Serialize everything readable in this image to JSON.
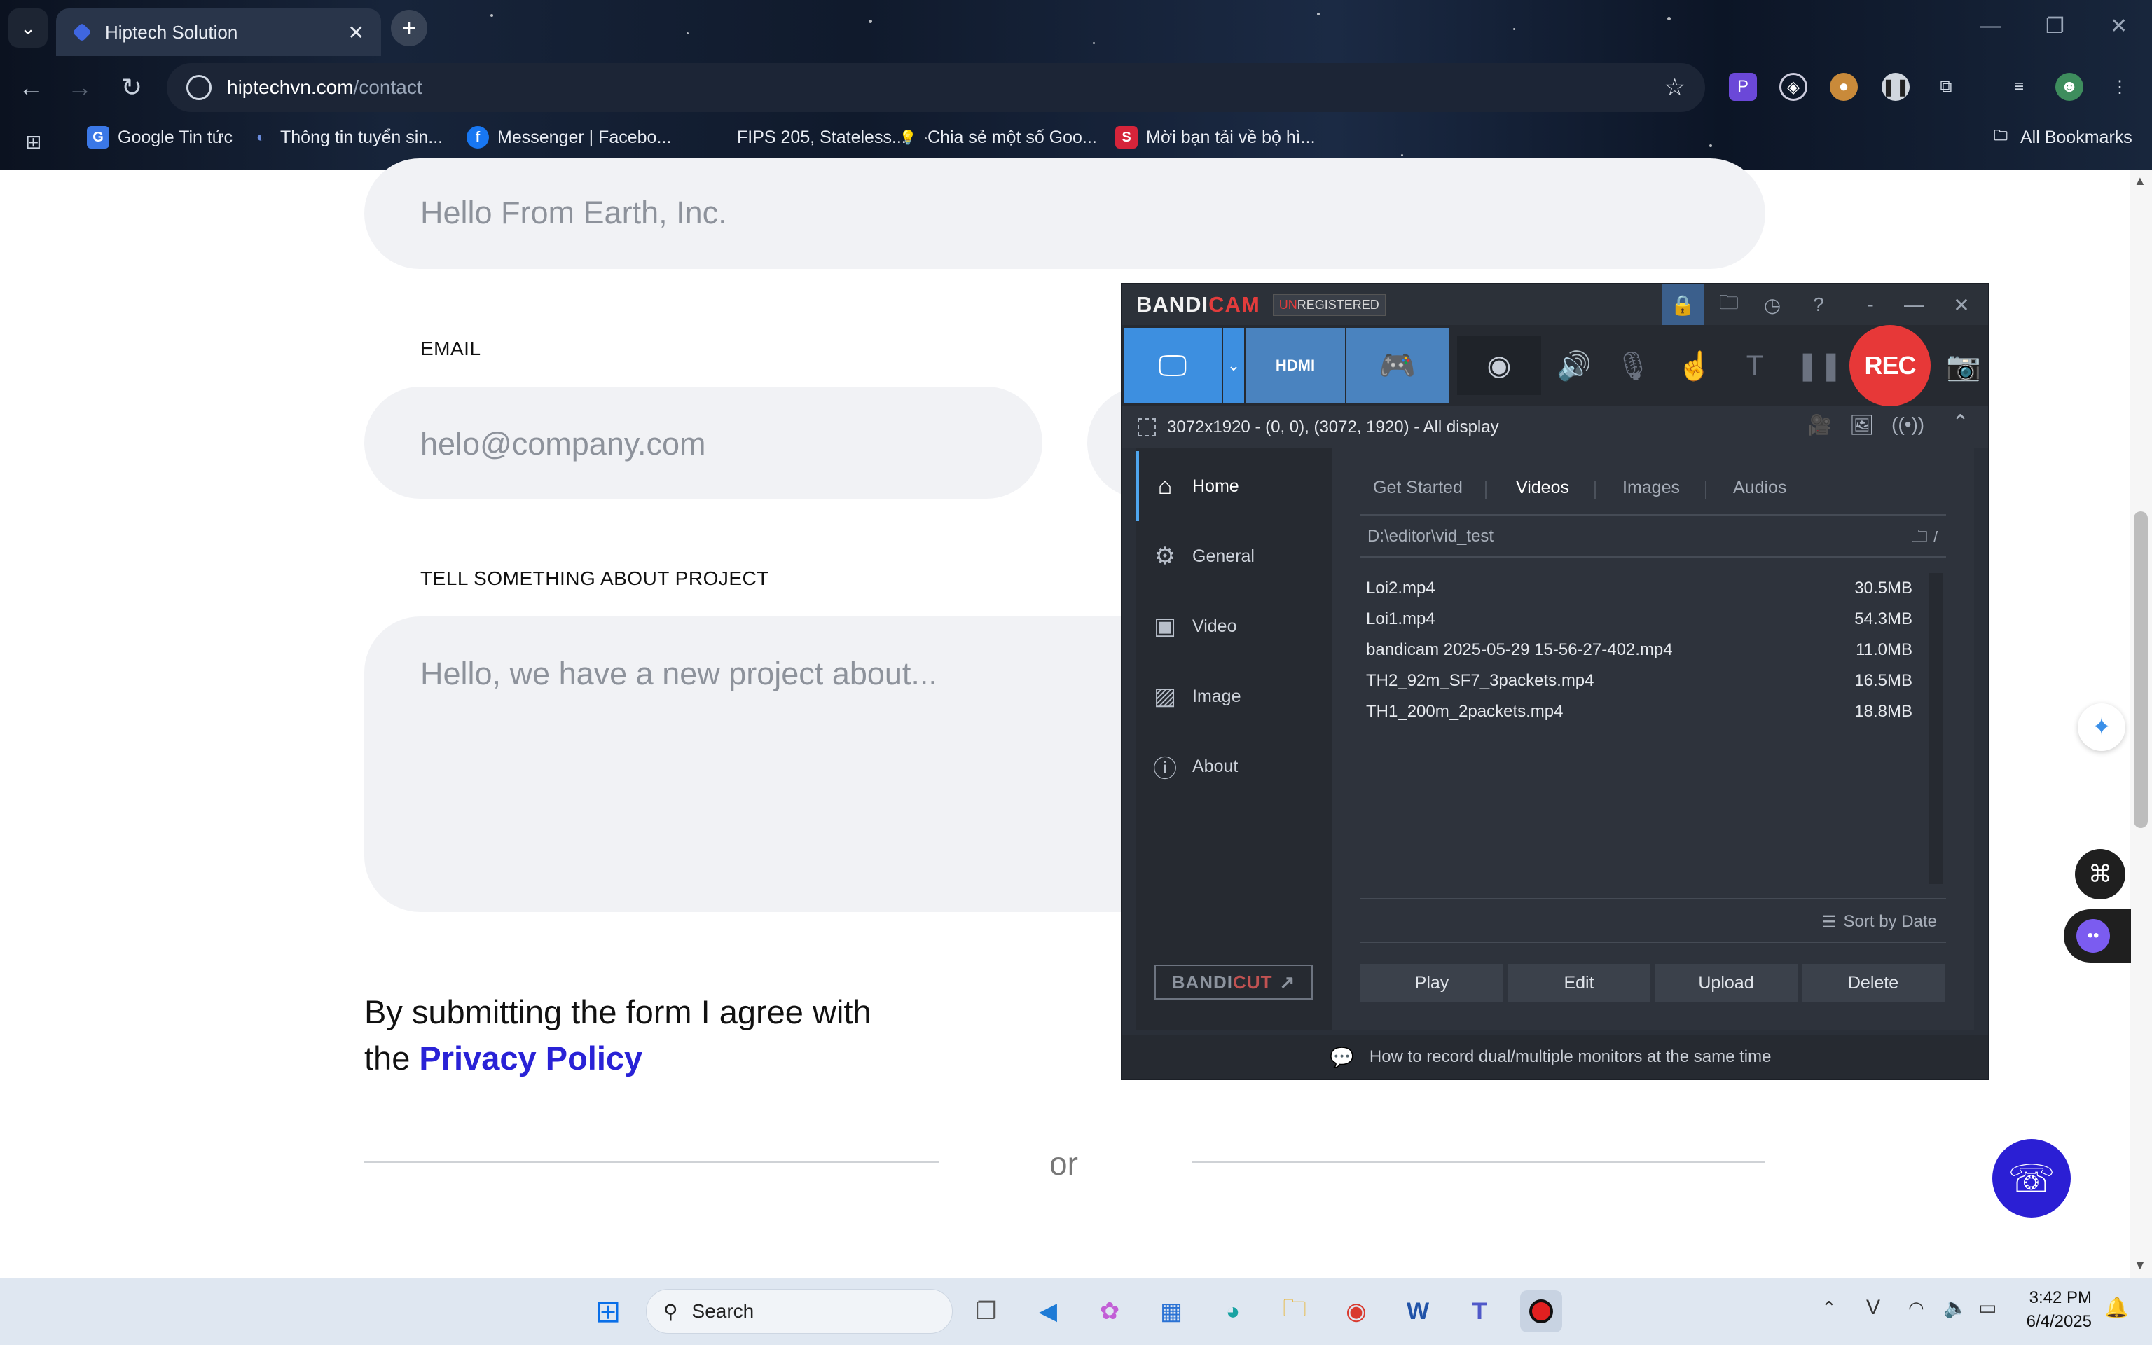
{
  "browser": {
    "tab_title": "Hiptech Solution",
    "url_host": "hiptechvn.com",
    "url_path": "/contact",
    "bookmarks": [
      "Google Tin tức",
      "Thông tin tuyển sin...",
      "Messenger | Facebo...",
      "FIPS 205, Stateless...",
      "Chia sẻ một số Goo...",
      "Mời bạn tải về bộ hì..."
    ],
    "all_bookmarks": "All Bookmarks"
  },
  "form": {
    "company_placeholder": "Hello From Earth, Inc.",
    "email_label": "EMAIL",
    "email_placeholder": "helo@company.com",
    "project_label": "TELL SOMETHING ABOUT PROJECT",
    "project_placeholder": "Hello, we have a new project about...",
    "agree_line1": "By submitting the form I agree with",
    "agree_the": "the",
    "privacy_link": "Privacy Policy",
    "or": "or"
  },
  "bandicam": {
    "logo_a": "BANDI",
    "logo_b": "CAM",
    "unreg_a": "UN",
    "unreg_b": "REGISTERED",
    "rec_label": "REC",
    "capture_info": "3072x1920 - (0, 0), (3072, 1920) - All display",
    "nav": [
      "Home",
      "General",
      "Video",
      "Image",
      "About"
    ],
    "tabs": [
      "Get Started",
      "Videos",
      "Images",
      "Audios"
    ],
    "selected_tab": "Videos",
    "path": "D:\\editor\\vid_test",
    "path_slash": "/",
    "files": [
      {
        "name": "Loi2.mp4",
        "size": "30.5MB"
      },
      {
        "name": "Loi1.mp4",
        "size": "54.3MB"
      },
      {
        "name": "bandicam 2025-05-29 15-56-27-402.mp4",
        "size": "11.0MB"
      },
      {
        "name": "TH2_92m_SF7_3packets.mp4",
        "size": "16.5MB"
      },
      {
        "name": "TH1_200m_2packets.mp4",
        "size": "18.8MB"
      }
    ],
    "sort_label": "Sort by Date",
    "buttons": [
      "Play",
      "Edit",
      "Upload",
      "Delete"
    ],
    "bandicut_a": "BANDI",
    "bandicut_b": "CUT",
    "footer_tip": "How to record dual/multiple monitors at the same time",
    "mode_hdmi": "HDMI"
  },
  "taskbar": {
    "search": "Search",
    "time": "3:42 PM",
    "date": "6/4/2025"
  },
  "colors": {
    "accent_link": "#2922d6",
    "rec_red": "#e73838",
    "bandicam_blue": "#3d8fe0"
  }
}
